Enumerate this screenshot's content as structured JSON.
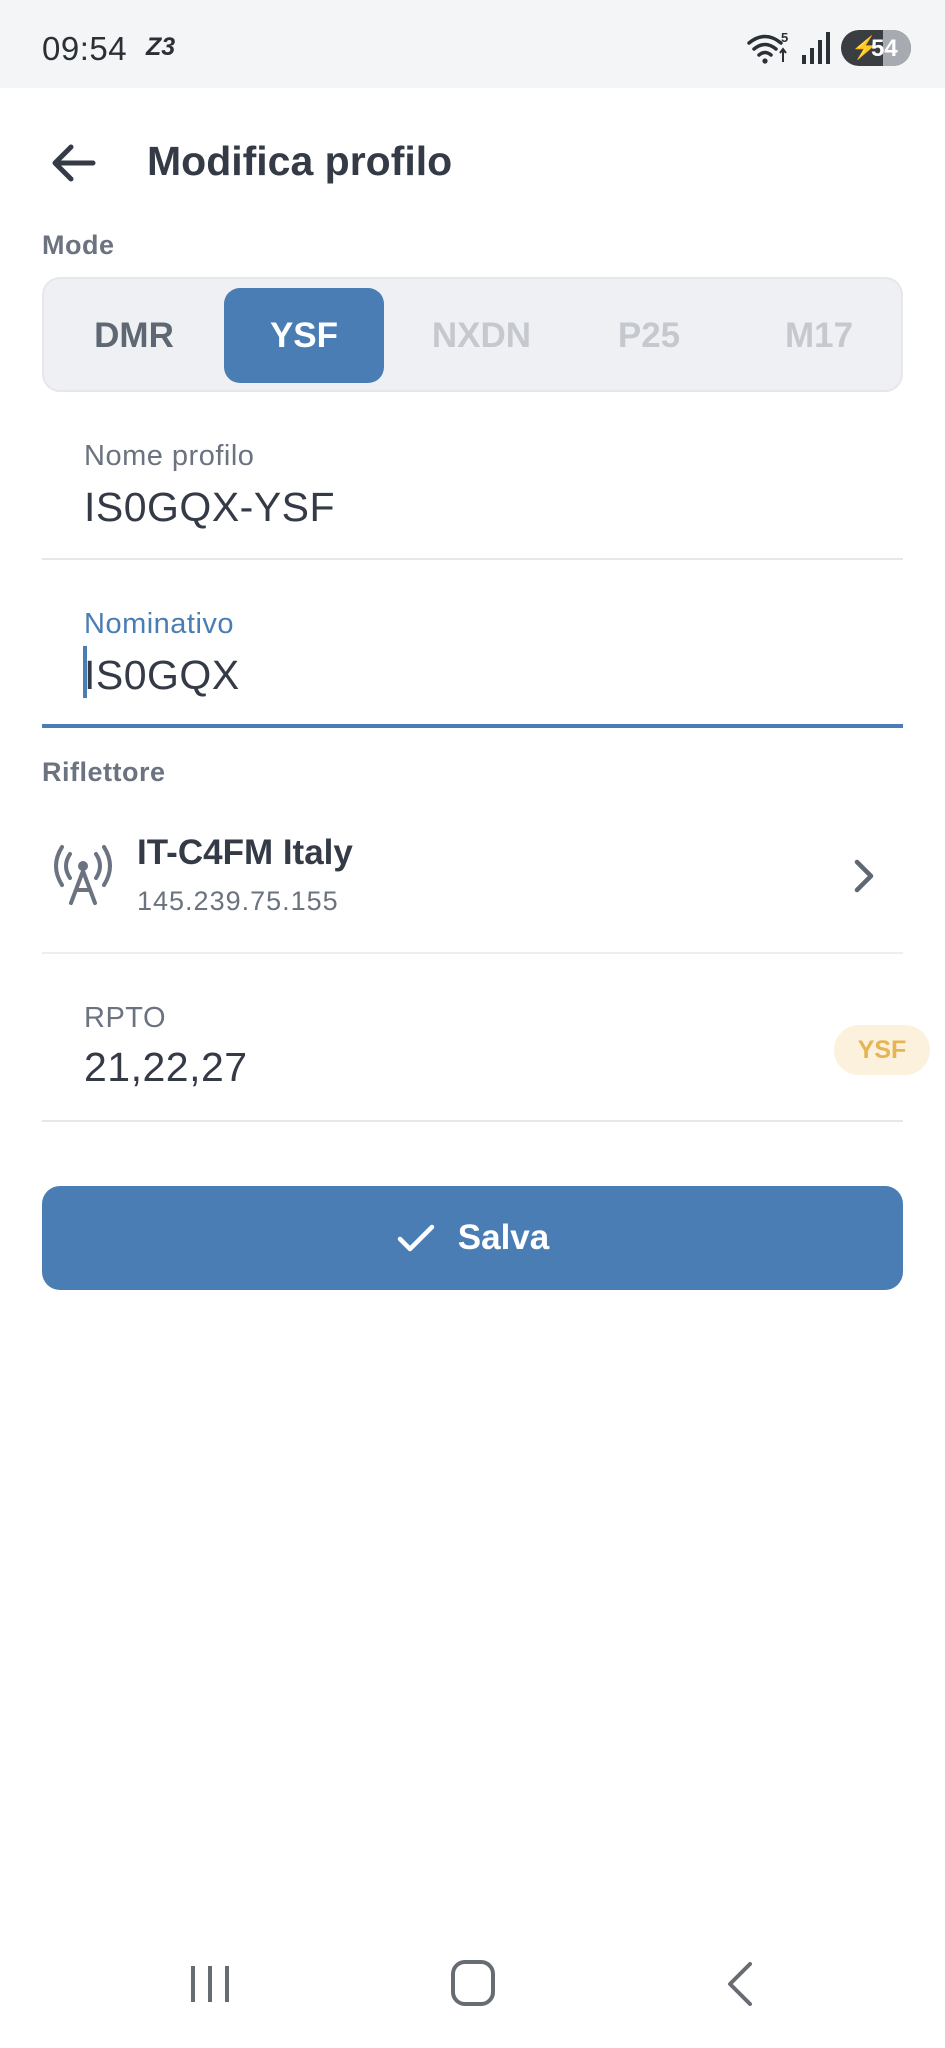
{
  "status_bar": {
    "time": "09:54",
    "carrier": "Z3",
    "wifi_badge": "5",
    "battery_level": "54"
  },
  "header": {
    "title": "Modifica profilo",
    "back_icon": "arrow-left-icon"
  },
  "mode": {
    "label": "Mode",
    "options": [
      {
        "label": "DMR",
        "state": "enabled"
      },
      {
        "label": "YSF",
        "state": "selected"
      },
      {
        "label": "NXDN",
        "state": "disabled"
      },
      {
        "label": "P25",
        "state": "disabled"
      },
      {
        "label": "M17",
        "state": "disabled"
      }
    ]
  },
  "fields": {
    "profile_name": {
      "label": "Nome profilo",
      "value": "IS0GQX-YSF"
    },
    "callsign": {
      "label": "Nominativo",
      "value": "IS0GQX"
    }
  },
  "reflector": {
    "section_label": "Riflettore",
    "name": "IT-C4FM Italy",
    "address": "145.239.75.155",
    "icon": "antenna-icon"
  },
  "rpto": {
    "label": "RPTO",
    "value": "21,22,27",
    "badge": "YSF"
  },
  "actions": {
    "save_label": "Salva",
    "save_icon": "check-icon"
  },
  "colors": {
    "accent": "#4a7db4",
    "badge_bg": "#fcf1dc",
    "badge_text": "#e5b454"
  }
}
